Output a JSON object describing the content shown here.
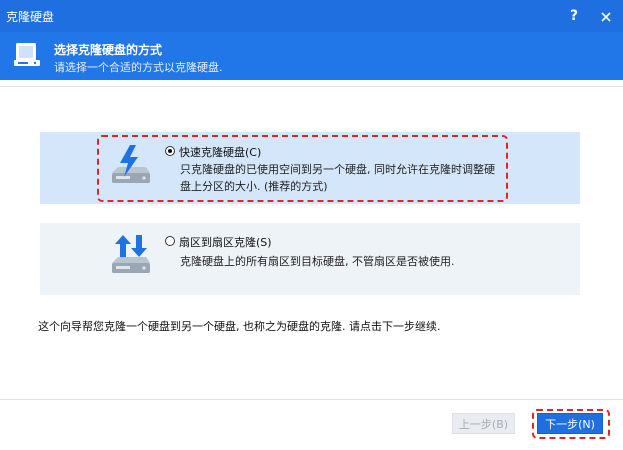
{
  "window": {
    "title": "克隆硬盘",
    "help_label": "?"
  },
  "header": {
    "title": "选择克隆硬盘的方式",
    "subtitle": "请选择一个合适的方式以克隆硬盘."
  },
  "options": [
    {
      "label": "快速克隆硬盘(C)",
      "description": "只克隆硬盘的已使用空间到另一个硬盘, 同时允许在克隆时调整硬盘上分区的大小. (推荐的方式)",
      "selected": true,
      "icon": "lightning-disk-icon"
    },
    {
      "label": "扇区到扇区克隆(S)",
      "description": "克隆硬盘上的所有扇区到目标硬盘, 不管扇区是否被使用.",
      "selected": false,
      "icon": "up-down-arrows-disk-icon"
    }
  ],
  "footer_note": "这个向导帮您克隆一个硬盘到另一个硬盘, 也称之为硬盘的克隆. 请点击下一步继续.",
  "buttons": {
    "prev": "上一步(B)",
    "next": "下一步(N)"
  },
  "colors": {
    "titlebar": "#1f6fe0",
    "header": "#2277e8",
    "selected_card": "#d4e7fa",
    "card": "#eef3f8",
    "highlight": "#e0252a"
  }
}
